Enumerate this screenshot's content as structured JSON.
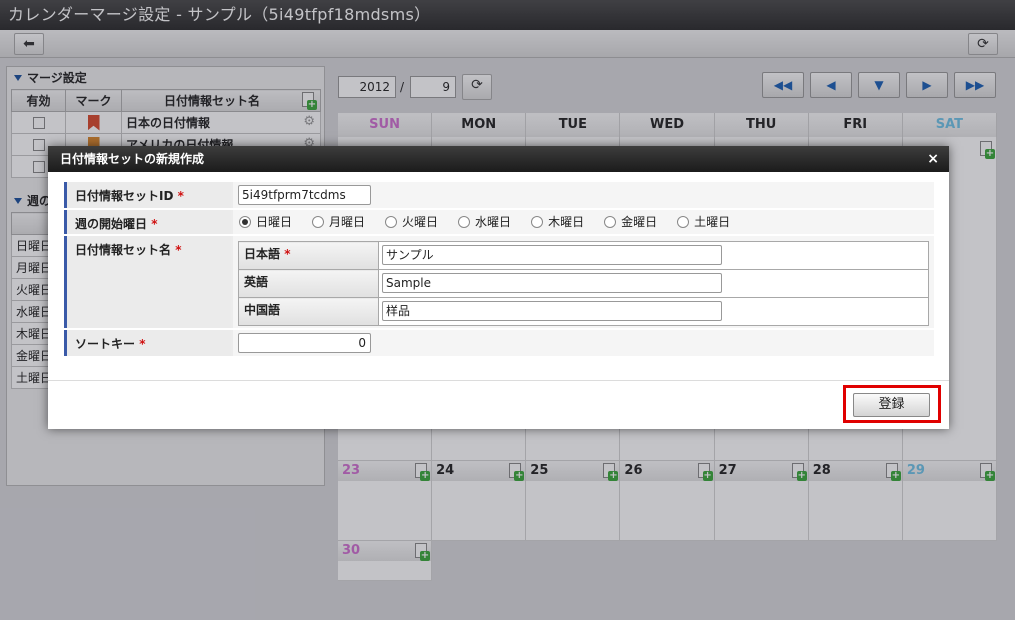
{
  "window": {
    "title": "カレンダーマージ設定 - サンプル（5i49tfpf18mdsms）"
  },
  "toolbar": {
    "back_icon": "arrow-left-icon",
    "refresh_icon": "refresh-icon"
  },
  "merge_panel": {
    "title": "マージ設定",
    "columns": [
      "有効",
      "マーク",
      "日付情報セット名"
    ],
    "rows": [
      {
        "enabled": false,
        "name": "日本の日付情報"
      },
      {
        "enabled": false,
        "name": "アメリカの日付情報"
      },
      {
        "enabled": false,
        "name": ""
      }
    ]
  },
  "week_panel": {
    "title": "週の",
    "days": [
      "日曜日",
      "月曜日",
      "火曜日",
      "水曜日",
      "木曜日",
      "金曜日",
      "土曜日"
    ],
    "friday_color": "#000000",
    "saturday_color": "#aaffff",
    "saturday_checked": true
  },
  "calendar": {
    "year": "2012",
    "separator": "/",
    "month": "9",
    "weekdays": [
      "SUN",
      "MON",
      "TUE",
      "WED",
      "THU",
      "FRI",
      "SAT"
    ],
    "row_days": [
      "23",
      "24",
      "25",
      "26",
      "27",
      "28",
      "29"
    ],
    "last_day": "30"
  },
  "dialog": {
    "title": "日付情報セットの新規作成",
    "close": "×",
    "id_label": "日付情報セットID",
    "id_value": "5i49tfprm7tcdms",
    "week_start_label": "週の開始曜日",
    "week_start_options": [
      "日曜日",
      "月曜日",
      "火曜日",
      "水曜日",
      "木曜日",
      "金曜日",
      "土曜日"
    ],
    "week_start_selected": "日曜日",
    "name_label": "日付情報セット名",
    "name_rows": [
      {
        "lang": "日本語",
        "required": true,
        "value": "サンプル"
      },
      {
        "lang": "英語",
        "required": false,
        "value": "Sample"
      },
      {
        "lang": "中国語",
        "required": false,
        "value": "样品"
      }
    ],
    "sort_key_label": "ソートキー",
    "sort_key_value": "0",
    "required_mark": "*",
    "register_label": "登録"
  }
}
